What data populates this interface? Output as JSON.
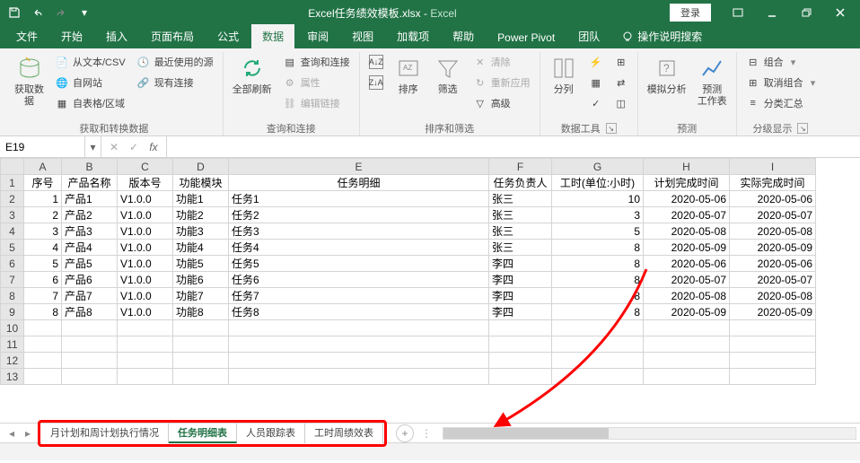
{
  "titlebar": {
    "filename": "Excel任务绩效模板.xlsx",
    "appname": "Excel",
    "login": "登录"
  },
  "tabs": {
    "file": "文件",
    "home": "开始",
    "insert": "插入",
    "pagelayout": "页面布局",
    "formulas": "公式",
    "data": "数据",
    "review": "审阅",
    "view": "视图",
    "addins": "加载项",
    "help": "帮助",
    "powerpivot": "Power Pivot",
    "team": "团队",
    "tellme": "操作说明搜索"
  },
  "ribbon": {
    "getdata": {
      "btn": "获取数\n据",
      "csv": "从文本/CSV",
      "web": "自网站",
      "table": "自表格/区域",
      "recent": "最近使用的源",
      "existing": "现有连接",
      "group": "获取和转换数据"
    },
    "refresh": {
      "btn": "全部刷新",
      "queries": "查询和连接",
      "props": "属性",
      "links": "编辑链接",
      "group": "查询和连接"
    },
    "sort": {
      "sort": "排序",
      "filter": "筛选",
      "clear": "清除",
      "reapply": "重新应用",
      "advanced": "高级",
      "group": "排序和筛选"
    },
    "datatools": {
      "split": "分列",
      "group": "数据工具"
    },
    "forecast": {
      "whatif": "模拟分析",
      "sheet": "预测\n工作表",
      "group": "预测"
    },
    "outline": {
      "group_btn": "组合",
      "ungroup": "取消组合",
      "subtotal": "分类汇总",
      "group": "分级显示"
    }
  },
  "formula": {
    "ref": "E19"
  },
  "columns": [
    "A",
    "B",
    "C",
    "D",
    "E",
    "F",
    "G",
    "H",
    "I"
  ],
  "headers": {
    "A": "序号",
    "B": "产品名称",
    "C": "版本号",
    "D": "功能模块",
    "E": "任务明细",
    "F": "任务负责人",
    "G": "工时(单位:小时)",
    "H": "计划完成时间",
    "I": "实际完成时间"
  },
  "rows": [
    {
      "n": 1,
      "A": "1",
      "B": "产品1",
      "C": "V1.0.0",
      "D": "功能1",
      "E": "任务1",
      "F": "张三",
      "G": "10",
      "H": "2020-05-06",
      "I": "2020-05-06"
    },
    {
      "n": 2,
      "A": "2",
      "B": "产品2",
      "C": "V1.0.0",
      "D": "功能2",
      "E": "任务2",
      "F": "张三",
      "G": "3",
      "H": "2020-05-07",
      "I": "2020-05-07"
    },
    {
      "n": 3,
      "A": "3",
      "B": "产品3",
      "C": "V1.0.0",
      "D": "功能3",
      "E": "任务3",
      "F": "张三",
      "G": "5",
      "H": "2020-05-08",
      "I": "2020-05-08"
    },
    {
      "n": 4,
      "A": "4",
      "B": "产品4",
      "C": "V1.0.0",
      "D": "功能4",
      "E": "任务4",
      "F": "张三",
      "G": "8",
      "H": "2020-05-09",
      "I": "2020-05-09"
    },
    {
      "n": 5,
      "A": "5",
      "B": "产品5",
      "C": "V1.0.0",
      "D": "功能5",
      "E": "任务5",
      "F": "李四",
      "G": "8",
      "H": "2020-05-06",
      "I": "2020-05-06"
    },
    {
      "n": 6,
      "A": "6",
      "B": "产品6",
      "C": "V1.0.0",
      "D": "功能6",
      "E": "任务6",
      "F": "李四",
      "G": "8",
      "H": "2020-05-07",
      "I": "2020-05-07"
    },
    {
      "n": 7,
      "A": "7",
      "B": "产品7",
      "C": "V1.0.0",
      "D": "功能7",
      "E": "任务7",
      "F": "李四",
      "G": "8",
      "H": "2020-05-08",
      "I": "2020-05-08"
    },
    {
      "n": 8,
      "A": "8",
      "B": "产品8",
      "C": "V1.0.0",
      "D": "功能8",
      "E": "任务8",
      "F": "李四",
      "G": "8",
      "H": "2020-05-09",
      "I": "2020-05-09"
    }
  ],
  "empty_rows": [
    10,
    11,
    12,
    13
  ],
  "sheets": {
    "s1": "月计划和周计划执行情况",
    "s2": "任务明细表",
    "s3": "人员跟踪表",
    "s4": "工时周绩效表"
  }
}
